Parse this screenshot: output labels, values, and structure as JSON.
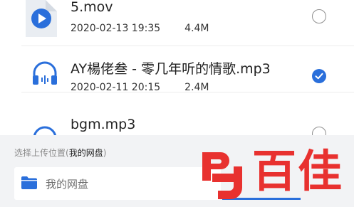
{
  "files": [
    {
      "name": "5.mov",
      "date": "2020-02-13 19:35",
      "size": "4.4M",
      "type_icon": "video-file-icon",
      "selected": false
    },
    {
      "name": "AY楊佬叁 - 零几年听的情歌.mp3",
      "date": "2020-02-11 20:15",
      "size": "2.4M",
      "type_icon": "audio-file-icon",
      "selected": true
    },
    {
      "name": "bgm.mp3",
      "type_icon": "audio-file-icon",
      "selected": false
    }
  ],
  "upload_location": {
    "label_prefix": "选择上传位置(",
    "label_target": "我的网盘",
    "label_suffix": ")",
    "current_path": "我的网盘",
    "folder_icon": "folder-icon"
  },
  "watermark": {
    "text": "百佳",
    "logo_icon": "bj-logo-icon"
  },
  "colors": {
    "accent": "#2a6fdb",
    "watermark_red": "#e8312f"
  }
}
